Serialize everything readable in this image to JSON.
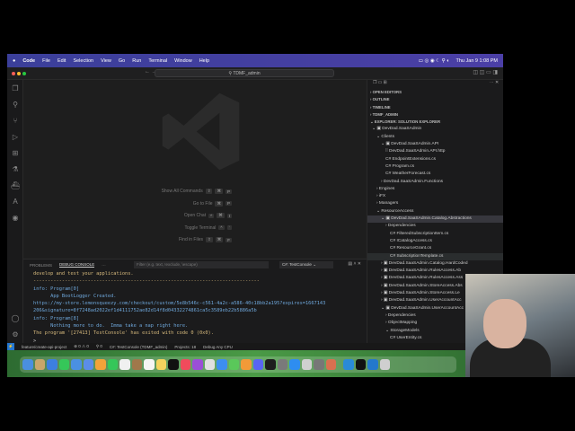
{
  "menubar": {
    "apple": "",
    "items": [
      "Code",
      "File",
      "Edit",
      "Selection",
      "View",
      "Go",
      "Run",
      "Terminal",
      "Window",
      "Help"
    ],
    "clock": "Thu Jan 9  1:08 PM"
  },
  "titlebar": {
    "search": "TDMF_admin"
  },
  "editor": {
    "shortcuts": [
      {
        "label": "Show All Commands",
        "keys": [
          "⇧",
          "⌘",
          "P"
        ]
      },
      {
        "label": "Go to File",
        "keys": [
          "⌘",
          "P"
        ]
      },
      {
        "label": "Open Chat",
        "keys": [
          "^",
          "⌘",
          "I"
        ]
      },
      {
        "label": "Toggle Terminal",
        "keys": [
          "^",
          "`"
        ]
      },
      {
        "label": "Find in Files",
        "keys": [
          "⇧",
          "⌘",
          "F"
        ]
      }
    ]
  },
  "panel": {
    "tabs": [
      "PROBLEMS",
      "DEBUG CONSOLE",
      "···"
    ],
    "filter_placeholder": "Filter (e.g. text, !exclude, \\escape)",
    "config": "C#: TestConsole",
    "lines": [
      {
        "c": "y",
        "t": "develop and test your applications."
      },
      {
        "c": "y",
        "t": "-------------------------------------------------------------------------------"
      },
      {
        "c": "b",
        "t": "info: Program[0]"
      },
      {
        "c": "b",
        "t": "      App BootLogger Created."
      },
      {
        "c": "b",
        "t": "https://my-store.lemonsqueezy.com/checkout/custom/5e8b546c-c561-4a2c-a586-40c18bb2a195?expires=1667143"
      },
      {
        "c": "b",
        "t": "206&signature=8f7248ad2022ef1d4111752ae82d14f8d04332274861ca5c3589eb22b5886a5b"
      },
      {
        "c": "b",
        "t": "info: Program[8]"
      },
      {
        "c": "b",
        "t": "      Nothing more to do.  Imma take a nap right here."
      },
      {
        "c": "y",
        "t": "The program '[27413] TestConsole' has exited with code 0 (0x0)."
      },
      {
        "c": "",
        "t": ">"
      }
    ]
  },
  "status": {
    "branch": "feature/create-api-project",
    "errors": "⊗ 0 ⚠ 0",
    "ports": "⚲ 0",
    "debug": "C#: TestConsole (TDMF_admin)",
    "projects": "Projects: 18",
    "config": "Debug Any CPU"
  },
  "sidebar": {
    "sections": [
      "OPEN EDITORS",
      "OUTLINE",
      "TIMELINE",
      "TDMF_ADMIN",
      "EXPLORER: SOLUTION EXPLORER"
    ],
    "tree": [
      {
        "d": 1,
        "t": "⌄ ▣ DevDad.SaaSAdmin"
      },
      {
        "d": 2,
        "t": "⌄ Clients"
      },
      {
        "d": 3,
        "t": "⌄ ▣ DevDad.SaaSAdmin.API"
      },
      {
        "d": 4,
        "t": "⁞⁞ DevDad.SaaSAdmin.API.http"
      },
      {
        "d": 4,
        "t": "C# EndpointExtensions.cs"
      },
      {
        "d": 4,
        "t": "C# Program.cs"
      },
      {
        "d": 4,
        "t": "C# WeatherForecast.cs"
      },
      {
        "d": 3,
        "t": "› DevDad.SaaSAdmin.Functions"
      },
      {
        "d": 2,
        "t": "› Engines"
      },
      {
        "d": 2,
        "t": "› iFX"
      },
      {
        "d": 2,
        "t": "› Managers"
      },
      {
        "d": 2,
        "t": "⌄ ResourceAccess"
      },
      {
        "d": 3,
        "t": "⌄ ▣ DevDad.SaaSAdmin.Catalog.Abstractions",
        "sel": true
      },
      {
        "d": 4,
        "t": "› Dependencies"
      },
      {
        "d": 5,
        "t": "C# FilteredSubscriptionItem.cs"
      },
      {
        "d": 5,
        "t": "C# ICatalogAccess.cs"
      },
      {
        "d": 5,
        "t": "C# ResourceGrant.cs"
      },
      {
        "d": 5,
        "t": "C# SubscriptionTemplate.cs",
        "hover": true
      },
      {
        "d": 3,
        "t": "› ▣ DevDad.SaaSAdmin.Catalog.HardCoded"
      },
      {
        "d": 3,
        "t": "› ▣ DevDad.SaaSAdmin.RulesAccess.Ab"
      },
      {
        "d": 3,
        "t": "› ▣ DevDad.SaaSAdmin.RulesAccess.Ass"
      },
      {
        "d": 3,
        "t": "› ▣ DevDad.SaaSAdmin.StoreAccess.Abs"
      },
      {
        "d": 3,
        "t": "› ▣ DevDad.SaaSAdmin.StoreAccess.Le"
      },
      {
        "d": 3,
        "t": "› ▣ DevDad.SaaSAdmin.UserAccountAcc"
      },
      {
        "d": 3,
        "t": "⌄ ▣ DevDad.SaaSAdmin.UserAccountAcc"
      },
      {
        "d": 4,
        "t": "› Dependencies"
      },
      {
        "d": 4,
        "t": "› ObjectMapping"
      },
      {
        "d": 4,
        "t": "⌄ StorageModels"
      },
      {
        "d": 5,
        "t": "C# UserEntity.cs"
      }
    ]
  },
  "dock_colors": [
    "#4a8fe0",
    "#c9a66b",
    "#3d7fe0",
    "#35c759",
    "#4a90e2",
    "#5b8de8",
    "#f2a33a",
    "#35c759",
    "#f0f0f0",
    "#a0784b",
    "#f5f5f5",
    "#f4d35e",
    "#111111",
    "#f04b5c",
    "#9b4fd6",
    "#e0e0e0",
    "#3d8ef0",
    "#5ac85a",
    "#f29a38",
    "#5865f2",
    "#1e1e1e",
    "#7a7a7a",
    "#2e8df0",
    "#d0d0d0",
    "#777777",
    "#d87050",
    "#2a8ad8",
    "#111111",
    "#2478cc",
    "#cfcfcf"
  ]
}
